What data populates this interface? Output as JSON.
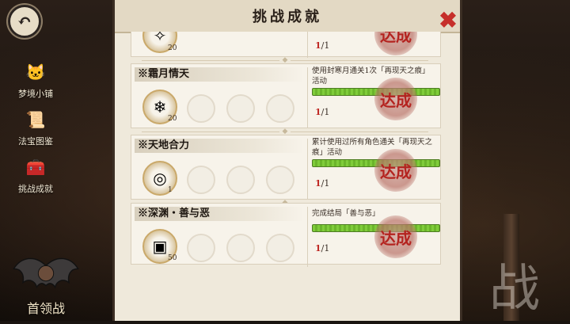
{
  "panel": {
    "title": "挑战成就"
  },
  "sidebar": [
    {
      "label": "梦境小铺",
      "icon": "cat-shop-icon"
    },
    {
      "label": "法宝图鉴",
      "icon": "treasure-book-icon"
    },
    {
      "label": "挑战成就",
      "icon": "achievement-chest-icon"
    }
  ],
  "boss": {
    "label": "首领战"
  },
  "decor": {
    "zhan": "战"
  },
  "colors": {
    "accent": "#c62f2a",
    "progress_green": "#7fcc3a",
    "panel_bg": "#efe9db"
  },
  "achievements": [
    {
      "name": "",
      "reward_count": "20",
      "description": "",
      "progress_current": "1",
      "progress_total": "/1",
      "stamp": "达成"
    },
    {
      "name": "※霜月情天",
      "reward_count": "20",
      "description": "使用封寒月通关1次「再现天之痕」活动",
      "progress_current": "1",
      "progress_total": "/1",
      "stamp": "达成"
    },
    {
      "name": "※天地合力",
      "reward_count": "1",
      "description": "累计使用过所有角色通关「再现天之痕」活动",
      "progress_current": "1",
      "progress_total": "/1",
      "stamp": "达成"
    },
    {
      "name": "※深渊・善与恶",
      "reward_count": "50",
      "description": "完成结局「善与恶」",
      "progress_current": "1",
      "progress_total": "/1",
      "stamp": "达成"
    }
  ]
}
